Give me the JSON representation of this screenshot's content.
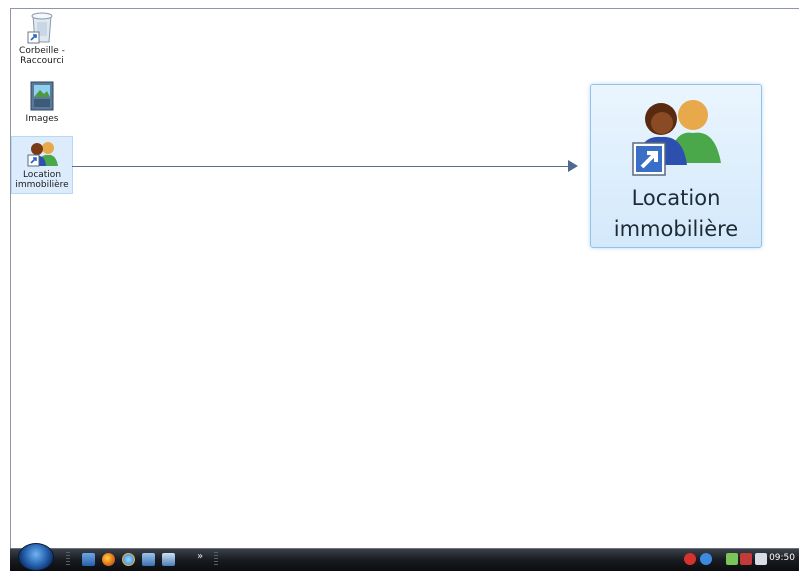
{
  "desktop": {
    "icons": [
      {
        "label_line1": "Corbeille -",
        "label_line2": "Raccourci"
      },
      {
        "label_line1": "Images",
        "label_line2": ""
      },
      {
        "label_line1": "Location",
        "label_line2": "immobilière"
      }
    ]
  },
  "zoom": {
    "line1": "Location",
    "line2": "immobilière"
  },
  "taskbar": {
    "more_label": "»",
    "clock": "09:50"
  }
}
